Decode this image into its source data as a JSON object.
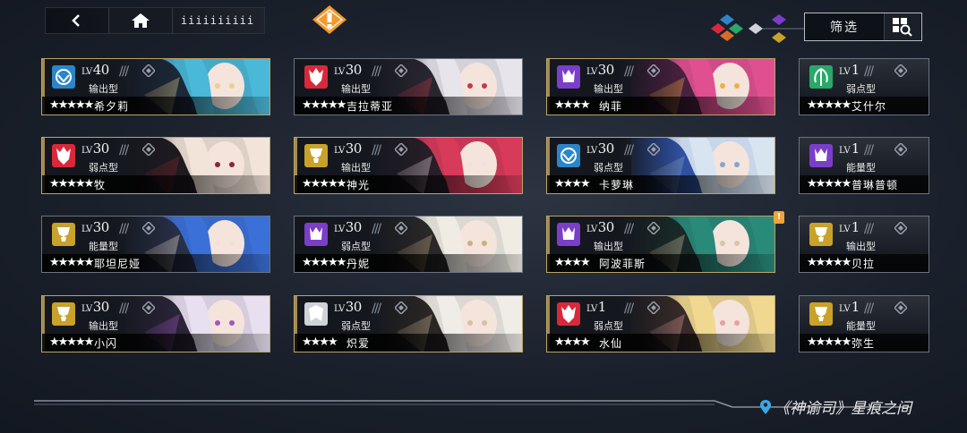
{
  "topbar": {
    "back_icon": "back-arrow-icon",
    "home_icon": "home-icon",
    "title": "iiiiiiiiii"
  },
  "alert": {
    "label": "!"
  },
  "filter": {
    "label": "筛选",
    "icon": "search-grid-icon"
  },
  "colors": {
    "accent_gold": "#c8a65e",
    "alert_orange": "#f0a43a",
    "background": "#1b212c",
    "role_fire": "#d8293a",
    "role_water": "#2a86c8",
    "role_wood": "#2aa86a",
    "role_dark": "#7a3ec8",
    "role_light": "#c8a22a",
    "role_neutral": "#cfd2d8"
  },
  "cards": [
    {
      "level": "40",
      "role": "输出型",
      "name": "希夕莉",
      "stars": "★★★★★",
      "element": "water",
      "gold": true,
      "portrait": [
        "#4ab8d8",
        "#e8d090",
        "#1c2838"
      ]
    },
    {
      "level": "30",
      "role": "输出型",
      "name": "吉拉蒂亚",
      "stars": "★★★★★",
      "element": "fire",
      "gold": false,
      "portrait": [
        "#e8e4ec",
        "#c23a4a",
        "#2a2630"
      ]
    },
    {
      "level": "30",
      "role": "输出型",
      "name": "纳菲",
      "stars": "★★★★",
      "element": "dark",
      "gold": true,
      "portrait": [
        "#e05090",
        "#f0b040",
        "#4a2040"
      ]
    },
    {
      "level": "1",
      "role": "弱点型",
      "name": "艾什尔",
      "stars": "★★★★★",
      "element": "wood",
      "gold": false
    },
    {
      "level": "30",
      "role": "弱点型",
      "name": "牧",
      "stars": "★★★★★",
      "element": "fire",
      "gold": true,
      "portrait": [
        "#f2e4d8",
        "#8a2830",
        "#1e1a20"
      ]
    },
    {
      "level": "30",
      "role": "输出型",
      "name": "神光",
      "stars": "★★★★★",
      "element": "light",
      "gold": true,
      "portrait": [
        "#d83a5a",
        "#f0e0e4",
        "#281e28"
      ]
    },
    {
      "level": "30",
      "role": "弱点型",
      "name": "卡萝琳",
      "stars": "★★★★",
      "element": "water",
      "gold": true,
      "portrait": [
        "#d8e4f0",
        "#8aa4c8",
        "#3050a0"
      ]
    },
    {
      "level": "1",
      "role": "能量型",
      "name": "普琳普顿",
      "stars": "★★★★★",
      "element": "dark",
      "gold": false
    },
    {
      "level": "30",
      "role": "能量型",
      "name": "耶坦尼娅",
      "stars": "★★★★★",
      "element": "light",
      "gold": false,
      "portrait": [
        "#3a70d8",
        "#f0e0d8",
        "#283048"
      ]
    },
    {
      "level": "30",
      "role": "弱点型",
      "name": "丹妮",
      "stars": "★★★★★",
      "element": "dark",
      "gold": false,
      "portrait": [
        "#f0ece4",
        "#c8b080",
        "#2a2828"
      ]
    },
    {
      "level": "30",
      "role": "输出型",
      "name": "阿波菲斯",
      "stars": "★★★★",
      "element": "dark",
      "gold": true,
      "portrait": [
        "#2a8a7a",
        "#d8c8a0",
        "#1a2a28"
      ]
    },
    {
      "level": "1",
      "role": "输出型",
      "name": "贝拉",
      "stars": "★★★★★",
      "element": "light",
      "gold": false
    },
    {
      "level": "30",
      "role": "输出型",
      "name": "小闪",
      "stars": "★★★★★",
      "element": "light",
      "gold": true,
      "portrait": [
        "#e8e0f0",
        "#a058c0",
        "#2a2438"
      ]
    },
    {
      "level": "30",
      "role": "弱点型",
      "name": "炽爱",
      "stars": "★★★★",
      "element": "neutral",
      "gold": true,
      "portrait": [
        "#f0ece8",
        "#d8c0a0",
        "#2a2624"
      ]
    },
    {
      "level": "1",
      "role": "弱点型",
      "name": "水仙",
      "stars": "★★★★",
      "element": "fire",
      "gold": true,
      "portrait": [
        "#f0d890",
        "#e8a0a0",
        "#382a28"
      ]
    },
    {
      "level": "1",
      "role": "能量型",
      "name": "弥生",
      "stars": "★★★★★",
      "element": "light",
      "gold": false
    }
  ],
  "card_alert": {
    "label": "!"
  },
  "location": {
    "text": "《神谕司》星痕之间",
    "icon": "location-pin-icon"
  }
}
